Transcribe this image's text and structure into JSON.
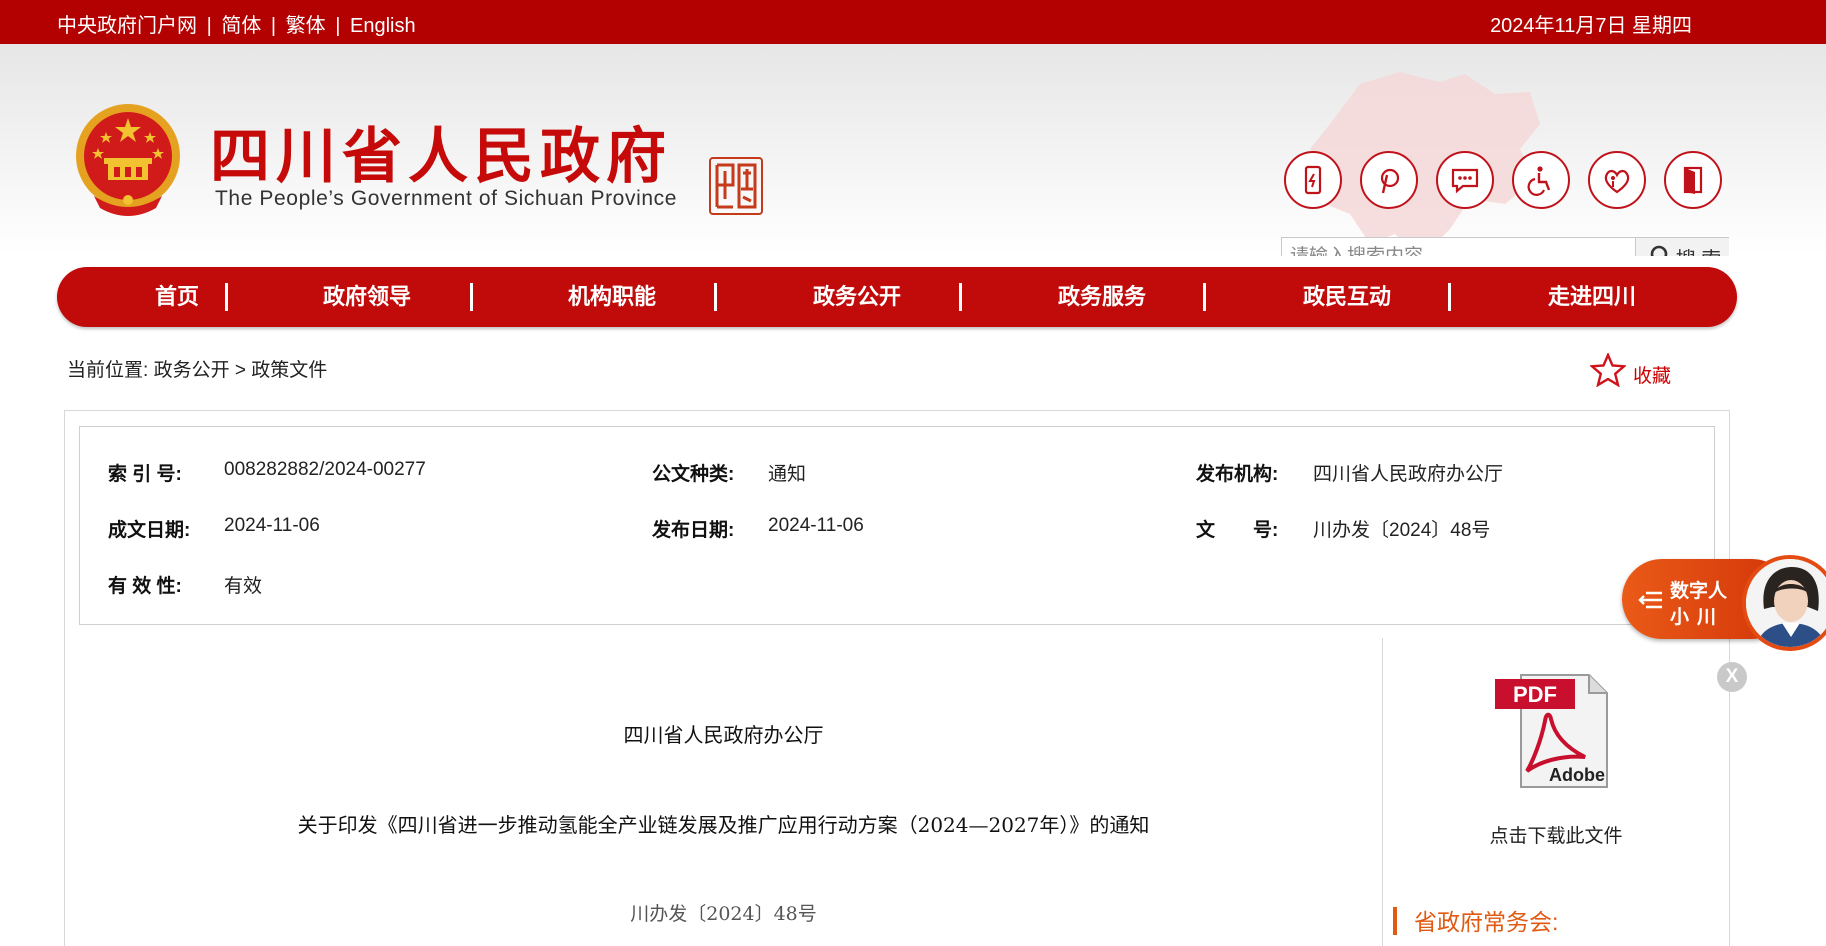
{
  "topbar": {
    "portal_link": "中央政府门户网",
    "sep": "|",
    "simplified": "简体",
    "traditional": "繁体",
    "english": "English",
    "date": "2024年11月7日 星期四"
  },
  "header": {
    "title": "四川省人民政府",
    "subtitle": "The People’s Government of Sichuan Province",
    "seal_text": "中國四川"
  },
  "tools": {
    "icons": [
      "mobile-icon",
      "weibo-icon",
      "message-icon",
      "accessibility-icon",
      "elderly-care-icon",
      "login-door-icon"
    ]
  },
  "search": {
    "placeholder": "请输入搜索内容",
    "button_label": "搜 索"
  },
  "nav": {
    "items": [
      "首页",
      "政府领导",
      "机构职能",
      "政务公开",
      "政务服务",
      "政民互动",
      "走进四川"
    ],
    "separator": "|"
  },
  "breadcrumb": {
    "prefix": "当前位置:",
    "level1": "政务公开",
    "arrow": ">",
    "level2": "政策文件"
  },
  "favorite": {
    "label": "收藏"
  },
  "meta": {
    "index_label": "索 引 号:",
    "index_value": "008282882/2024-00277",
    "type_label": "公文种类:",
    "type_value": "通知",
    "issuer_label": "发布机构:",
    "issuer_value": "四川省人民政府办公厅",
    "written_label": "成文日期:",
    "written_value": "2024-11-06",
    "published_label": "发布日期:",
    "published_value": "2024-11-06",
    "docno_label": "文　　号:",
    "docno_value": "川办发〔2024〕48号",
    "validity_label": "有 效 性:",
    "validity_value": "有效"
  },
  "document": {
    "org": "四川省人民政府办公厅",
    "title": "关于印发《四川省进一步推动氢能全产业链发展及推广应用行动方案（2024—2027年）》的通知",
    "number": "川办发〔2024〕48号"
  },
  "sidebar": {
    "pdf_badge": "PDF",
    "pdf_brand": "Adobe",
    "download_label": "点击下载此文件",
    "section_title": "省政府常务会:"
  },
  "assistant": {
    "line1": "数字人",
    "line2": "小川",
    "close": "X"
  },
  "colors": {
    "brand_red": "#c10a0a",
    "topbar_red": "#b30000",
    "accent_orange": "#e05a12"
  }
}
